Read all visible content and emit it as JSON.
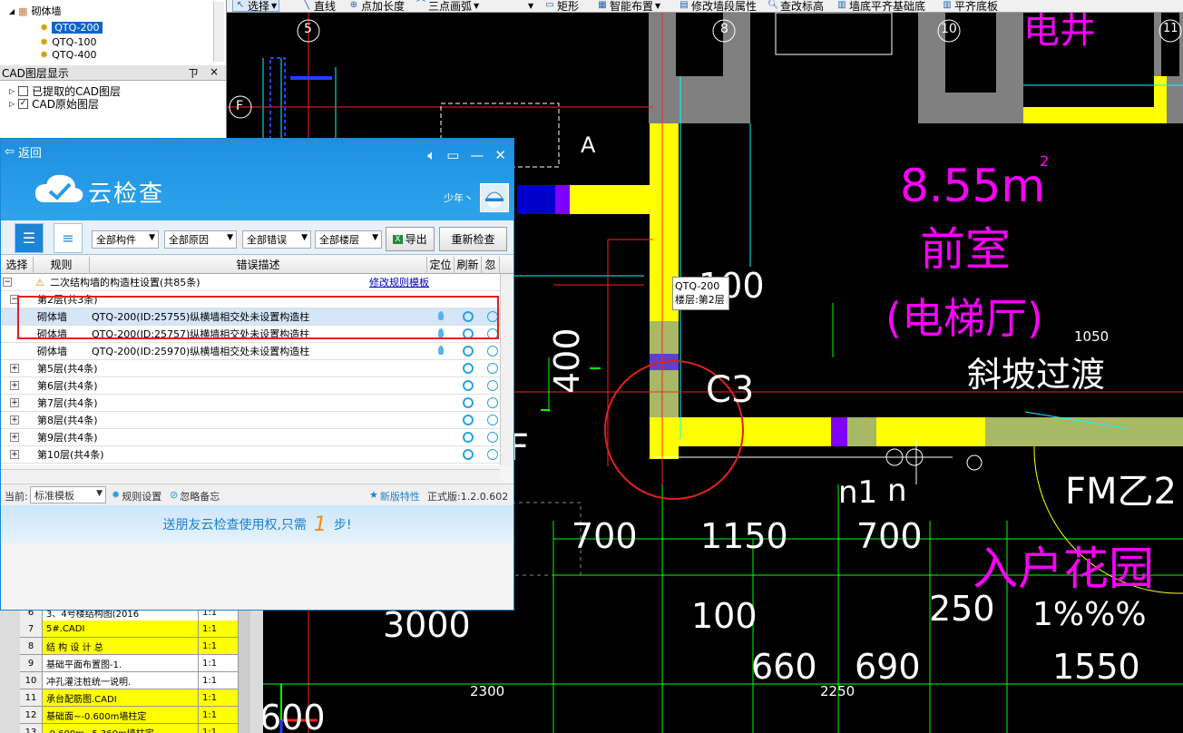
{
  "toolbar": {
    "select_label": "选择",
    "line_label": "直线",
    "point_length_label": "点加长度",
    "arc_label": "三点画弧",
    "rect_label": "矩形",
    "smart_layout_label": "智能布置",
    "modify_wall_label": "修改墙段属性",
    "check_elev_label": "查改标高",
    "wall_align_label": "墙底平齐基础底",
    "align_slab_label": "平齐底板"
  },
  "tree": {
    "root": "砌体墙",
    "items": [
      "QTQ-200",
      "QTQ-100",
      "QTQ-400"
    ]
  },
  "layers": {
    "title": "CAD图层显示",
    "pin": "ㄗ",
    "close": "×",
    "items": [
      {
        "label": "已提取的CAD图层",
        "checked": false
      },
      {
        "label": "CAD原始图层",
        "checked": true
      }
    ]
  },
  "cloud": {
    "back_label": "返回",
    "title": "云检查",
    "user": "少年丶",
    "filters": [
      "全部构件",
      "全部原因",
      "全部错误",
      "全部楼层"
    ],
    "export_label": "导出",
    "recheck_label": "重新检查",
    "columns": [
      "选择",
      "规则",
      "错误描述",
      "定位",
      "刷新",
      "忽略"
    ],
    "group_title": "二次结构墙的构造柱设置(共85条)",
    "modify_template_link": "修改规则模板",
    "floor2_label": "第2层(共3条)",
    "rows": [
      {
        "type": "砌体墙",
        "desc": "QTQ-200(ID:25755)纵横墙相交处未设置构造柱"
      },
      {
        "type": "砌体墙",
        "desc": "QTQ-200(ID:25757)纵横墙相交处未设置构造柱"
      },
      {
        "type": "砌体墙",
        "desc": "QTQ-200(ID:25970)纵横墙相交处未设置构造柱"
      }
    ],
    "floors": [
      "第5层(共4条)",
      "第6层(共4条)",
      "第7层(共4条)",
      "第8层(共4条)",
      "第9层(共4条)",
      "第10层(共4条)"
    ],
    "footer": {
      "current_label": "当前:",
      "template": "标准模板",
      "rule_settings": "规则设置",
      "ignore_memo": "忽略备忘",
      "new_features": "新版特性",
      "version": "正式版:1.2.0.602"
    },
    "promo": {
      "before": "送朋友云检查使用权,只需",
      "number": "1",
      "after": "步!"
    }
  },
  "bottom_list": [
    {
      "no": "6",
      "name": "3、4号楼结构图(2016",
      "scale": "1:1",
      "color": "white"
    },
    {
      "no": "7",
      "name": "5#.CADI",
      "scale": "1:1",
      "color": "yellow"
    },
    {
      "no": "8",
      "name": "结 构 设 计 总",
      "scale": "1:1",
      "color": "yellow"
    },
    {
      "no": "9",
      "name": "基础平面布置图-1.",
      "scale": "1:1",
      "color": "white"
    },
    {
      "no": "10",
      "name": "冲孔灌注桩统一说明.",
      "scale": "1:1",
      "color": "white"
    },
    {
      "no": "11",
      "name": "承台配筋图.CADI",
      "scale": "1:1",
      "color": "yellow"
    },
    {
      "no": "12",
      "name": "基础面~-0.600m墙柱定",
      "scale": "1:1",
      "color": "yellow"
    },
    {
      "no": "13",
      "name": "-0.600m~5.360m墙柱定",
      "scale": "1:1",
      "color": "yellow"
    }
  ],
  "tooltip": {
    "line1": "QTQ-200",
    "line2": "楼层:第2层"
  },
  "cad": {
    "axis_5": "5",
    "axis_8": "8",
    "axis_10": "10",
    "axis_11": "11",
    "axis_f": "F",
    "label_a": "A",
    "area": "8.55m",
    "area_sup": "2",
    "room1": "前室",
    "room2": "(电梯厅)",
    "elec": "电井",
    "slope": "斜坡过渡",
    "c3": "C3",
    "fm": "FM乙2",
    "garden": "入户花园",
    "pct": "1%%%",
    "n1": "n1",
    "n": "n",
    "f_side": "F",
    "dims": [
      "100",
      "1050",
      "400",
      "700",
      "1150",
      "700",
      "3000",
      "100",
      "250",
      "660",
      "690",
      "1550",
      "2300",
      "2250",
      "600"
    ]
  },
  "colors": {
    "magenta": "#ff00ff",
    "wall_yellow": "#ffff00",
    "wall_olive": "#a8b864",
    "wall_gray": "#808080"
  }
}
